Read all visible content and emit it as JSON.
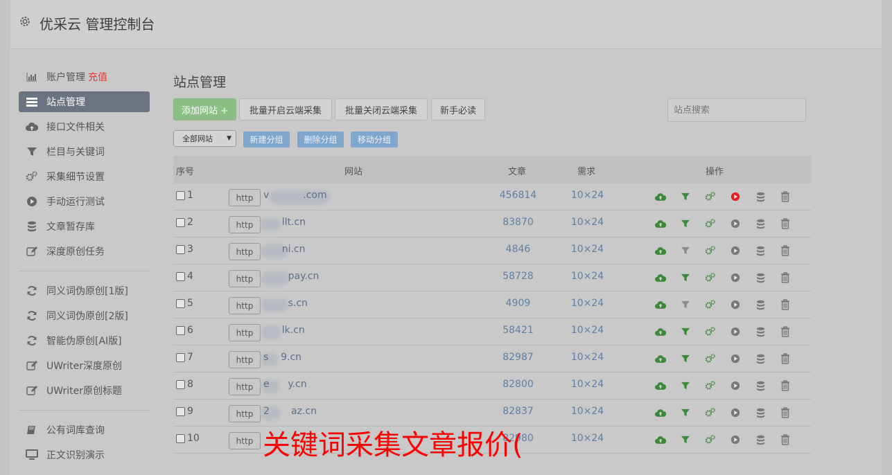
{
  "header": {
    "title": "优采云 管理控制台"
  },
  "sidebar": {
    "items": [
      {
        "label": "账户管理",
        "extra": "充值",
        "icon": "bar-chart-icon"
      },
      {
        "label": "站点管理",
        "icon": "list-icon",
        "active": true
      },
      {
        "label": "接口文件相关",
        "icon": "cloud-upload-icon"
      },
      {
        "label": "栏目与关键词",
        "icon": "filter-icon"
      },
      {
        "label": "采集细节设置",
        "icon": "cogs-icon"
      },
      {
        "label": "手动运行测试",
        "icon": "play-circle-icon"
      },
      {
        "label": "文章暂存库",
        "icon": "database-icon"
      },
      {
        "label": "深度原创任务",
        "icon": "edit-icon"
      },
      {
        "label": "同义词伪原创[1版]",
        "icon": "refresh-icon"
      },
      {
        "label": "同义词伪原创[2版]",
        "icon": "refresh-icon"
      },
      {
        "label": "智能伪原创[AI版]",
        "icon": "refresh-icon"
      },
      {
        "label": "UWriter深度原创",
        "icon": "edit-icon"
      },
      {
        "label": "UWriter原创标题",
        "icon": "edit-icon"
      },
      {
        "label": "公有词库查询",
        "icon": "book-icon"
      },
      {
        "label": "正文识别演示",
        "icon": "monitor-icon"
      }
    ]
  },
  "main": {
    "title": "站点管理",
    "toolbar": {
      "add_site": "添加网站 +",
      "batch_enable": "批量开启云端采集",
      "batch_disable": "批量关闭云端采集",
      "beginner": "新手必读",
      "search_placeholder": "站点搜索"
    },
    "group": {
      "select": "全部网站",
      "new_group": "新建分组",
      "delete_group": "删除分组",
      "move_group": "移动分组"
    },
    "table": {
      "headers": {
        "no": "序号",
        "site": "网站",
        "articles": "文章",
        "need": "需求",
        "ops": "操作"
      },
      "rows": [
        {
          "no": "1",
          "proto": "http",
          "site": "v           .com",
          "articles": "456814",
          "need": "10×24",
          "play_active": true
        },
        {
          "no": "2",
          "proto": "http",
          "site": "      llt.cn",
          "articles": "83870",
          "need": "10×24",
          "play_active": false
        },
        {
          "no": "3",
          "proto": "http",
          "site": "      ni.cn",
          "articles": "4846",
          "need": "10×24",
          "play_active": false
        },
        {
          "no": "4",
          "proto": "http",
          "site": "        pay.cn",
          "articles": "58728",
          "need": "10×24",
          "play_active": false
        },
        {
          "no": "5",
          "proto": "http",
          "site": "        s.cn",
          "articles": "4909",
          "need": "10×24",
          "play_active": false
        },
        {
          "no": "6",
          "proto": "http",
          "site": "      lk.cn",
          "articles": "58421",
          "need": "10×24",
          "play_active": false
        },
        {
          "no": "7",
          "proto": "http",
          "site": "s    9.cn",
          "articles": "82987",
          "need": "10×24",
          "play_active": false
        },
        {
          "no": "8",
          "proto": "http",
          "site": "e      y.cn",
          "articles": "82800",
          "need": "10×24",
          "play_active": false
        },
        {
          "no": "9",
          "proto": "http",
          "site": "2       az.cn",
          "articles": "82837",
          "need": "10×24",
          "play_active": false
        },
        {
          "no": "10",
          "proto": "http",
          "site": "",
          "articles": "82980",
          "need": "10×24",
          "play_active": false
        }
      ]
    }
  },
  "overlay_text": "关键词采集文章报价(",
  "colors": {
    "green": "#3a8a3a",
    "red": "#e02020",
    "blue": "#5d7fa5",
    "active_nav": "#6b7380"
  }
}
